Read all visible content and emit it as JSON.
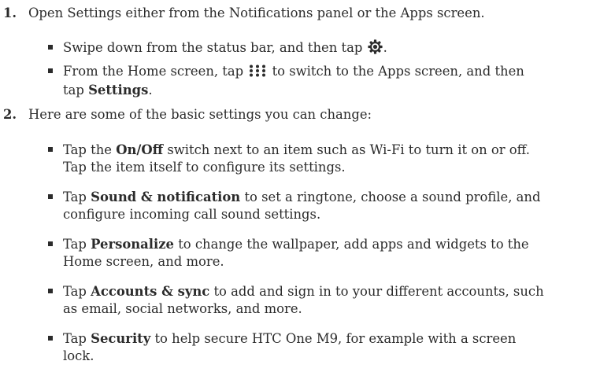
{
  "steps": [
    {
      "number": "1.",
      "text": "Open Settings either from the Notifications panel or the Apps screen."
    },
    {
      "number": "2.",
      "text": "Here are some of the basic settings you can change:"
    }
  ],
  "step1_bullets": {
    "b1_before": "Swipe down from the status bar, and then tap ",
    "b1_after": ".",
    "b2_before": "From the Home screen, tap ",
    "b2_after": " to switch to the Apps screen, and then",
    "b2_line2_before": "tap ",
    "b2_line2_bold": "Settings",
    "b2_line2_after": "."
  },
  "step2_bullets": [
    {
      "prefix": "Tap the ",
      "bold": "On/Off",
      "line1_rest": " switch next to an item such as Wi-Fi to turn it on or off.",
      "line2": "Tap the item itself to configure its settings."
    },
    {
      "prefix": "Tap ",
      "bold": "Sound & notification",
      "line1_rest": " to set a ringtone, choose a sound profile, and",
      "line2": "configure incoming call sound settings."
    },
    {
      "prefix": "Tap ",
      "bold": "Personalize",
      "line1_rest": " to change the wallpaper, add apps and widgets to the",
      "line2": "Home screen, and more."
    },
    {
      "prefix": "Tap ",
      "bold": "Accounts & sync",
      "line1_rest": " to add and sign in to your different accounts, such",
      "line2": "as email, social networks, and more."
    },
    {
      "prefix": "Tap ",
      "bold": "Security",
      "line1_rest": " to help secure HTC One M9, for example with a screen",
      "line2": "lock."
    }
  ],
  "icons": {
    "settings": "gear-icon",
    "apps": "apps-grid-icon"
  }
}
